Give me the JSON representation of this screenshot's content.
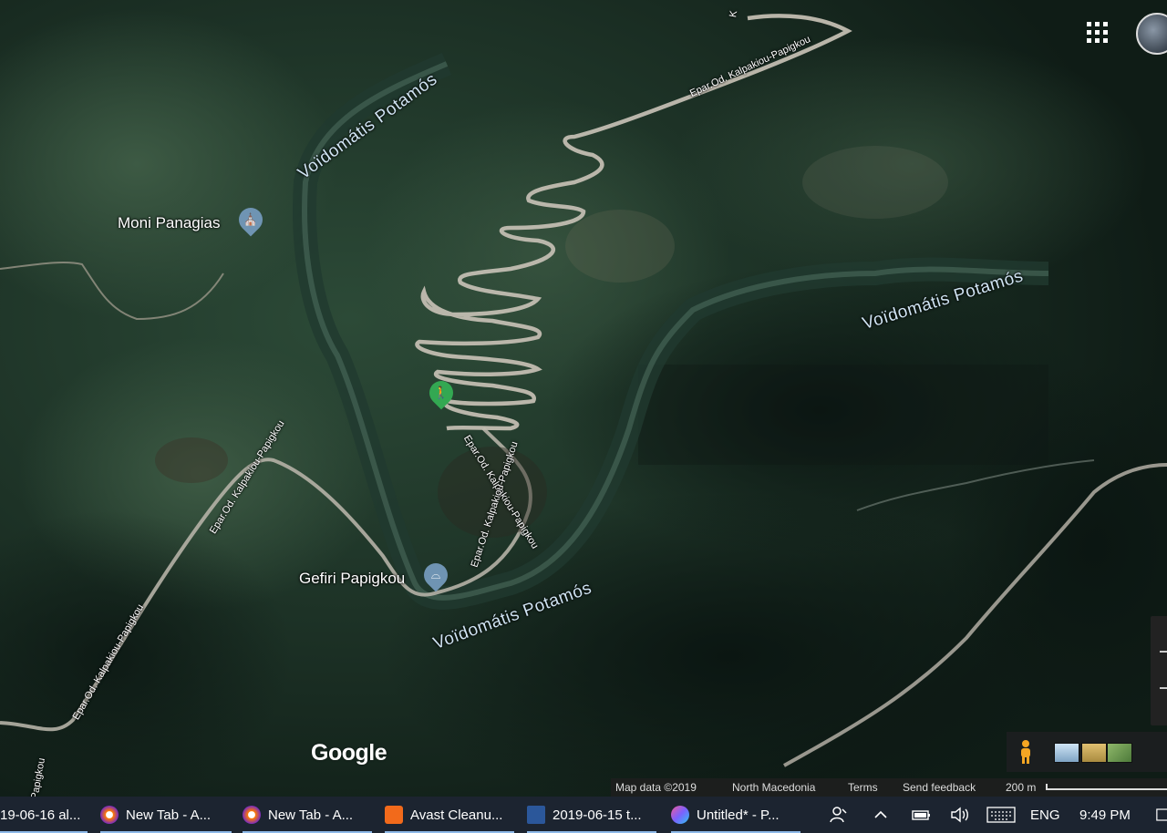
{
  "map": {
    "labels": {
      "river_top": "Voïdomátis Potamós",
      "river_right": "Voïdomátis Potamós",
      "river_bottom": "Voïdomátis Potamós",
      "road_top": "Epar.Od. Kalpakiou-Papigkou",
      "road_mid": "Epar.Od. Kalpakiou-Papigkou",
      "road_mid2": "Epar.Od. Kalpakiou-Papigkou",
      "road_left": "Epar.Od. Kalpakiou-Papigkou",
      "road_bottom_left": "Epar.Od. Kalpakiou-Papigkou",
      "road_edge": "Papigkou",
      "road_top_edge": "K"
    },
    "places": [
      {
        "name": "Moni Panagias",
        "icon": "monastery-icon"
      },
      {
        "name": "Gefiri Papigkou",
        "icon": "bridge-icon"
      }
    ],
    "hiking_marker": "hiking-icon",
    "logo": "Google",
    "attribution": {
      "map_data": "Map data ©2019",
      "region": "North Macedonia",
      "terms": "Terms",
      "feedback": "Send feedback",
      "scale": "200 m"
    },
    "colors": {
      "river_label": "#cfe3f2",
      "pin_blue": "#6f94b3",
      "pin_green": "#33a852",
      "road": "#bdb8ab"
    }
  },
  "taskbar": {
    "items": [
      {
        "label": "19-06-16 al...",
        "icon": "file-icon"
      },
      {
        "label": "New Tab - A...",
        "icon": "avast-browser-icon"
      },
      {
        "label": "New Tab - A...",
        "icon": "avast-browser-icon"
      },
      {
        "label": "Avast Cleanu...",
        "icon": "avast-cleanup-icon"
      },
      {
        "label": "2019-06-15 t...",
        "icon": "word-icon"
      },
      {
        "label": "Untitled* - P...",
        "icon": "paint3d-icon"
      }
    ],
    "tray": {
      "language": "ENG",
      "time": "9:49 PM"
    }
  }
}
